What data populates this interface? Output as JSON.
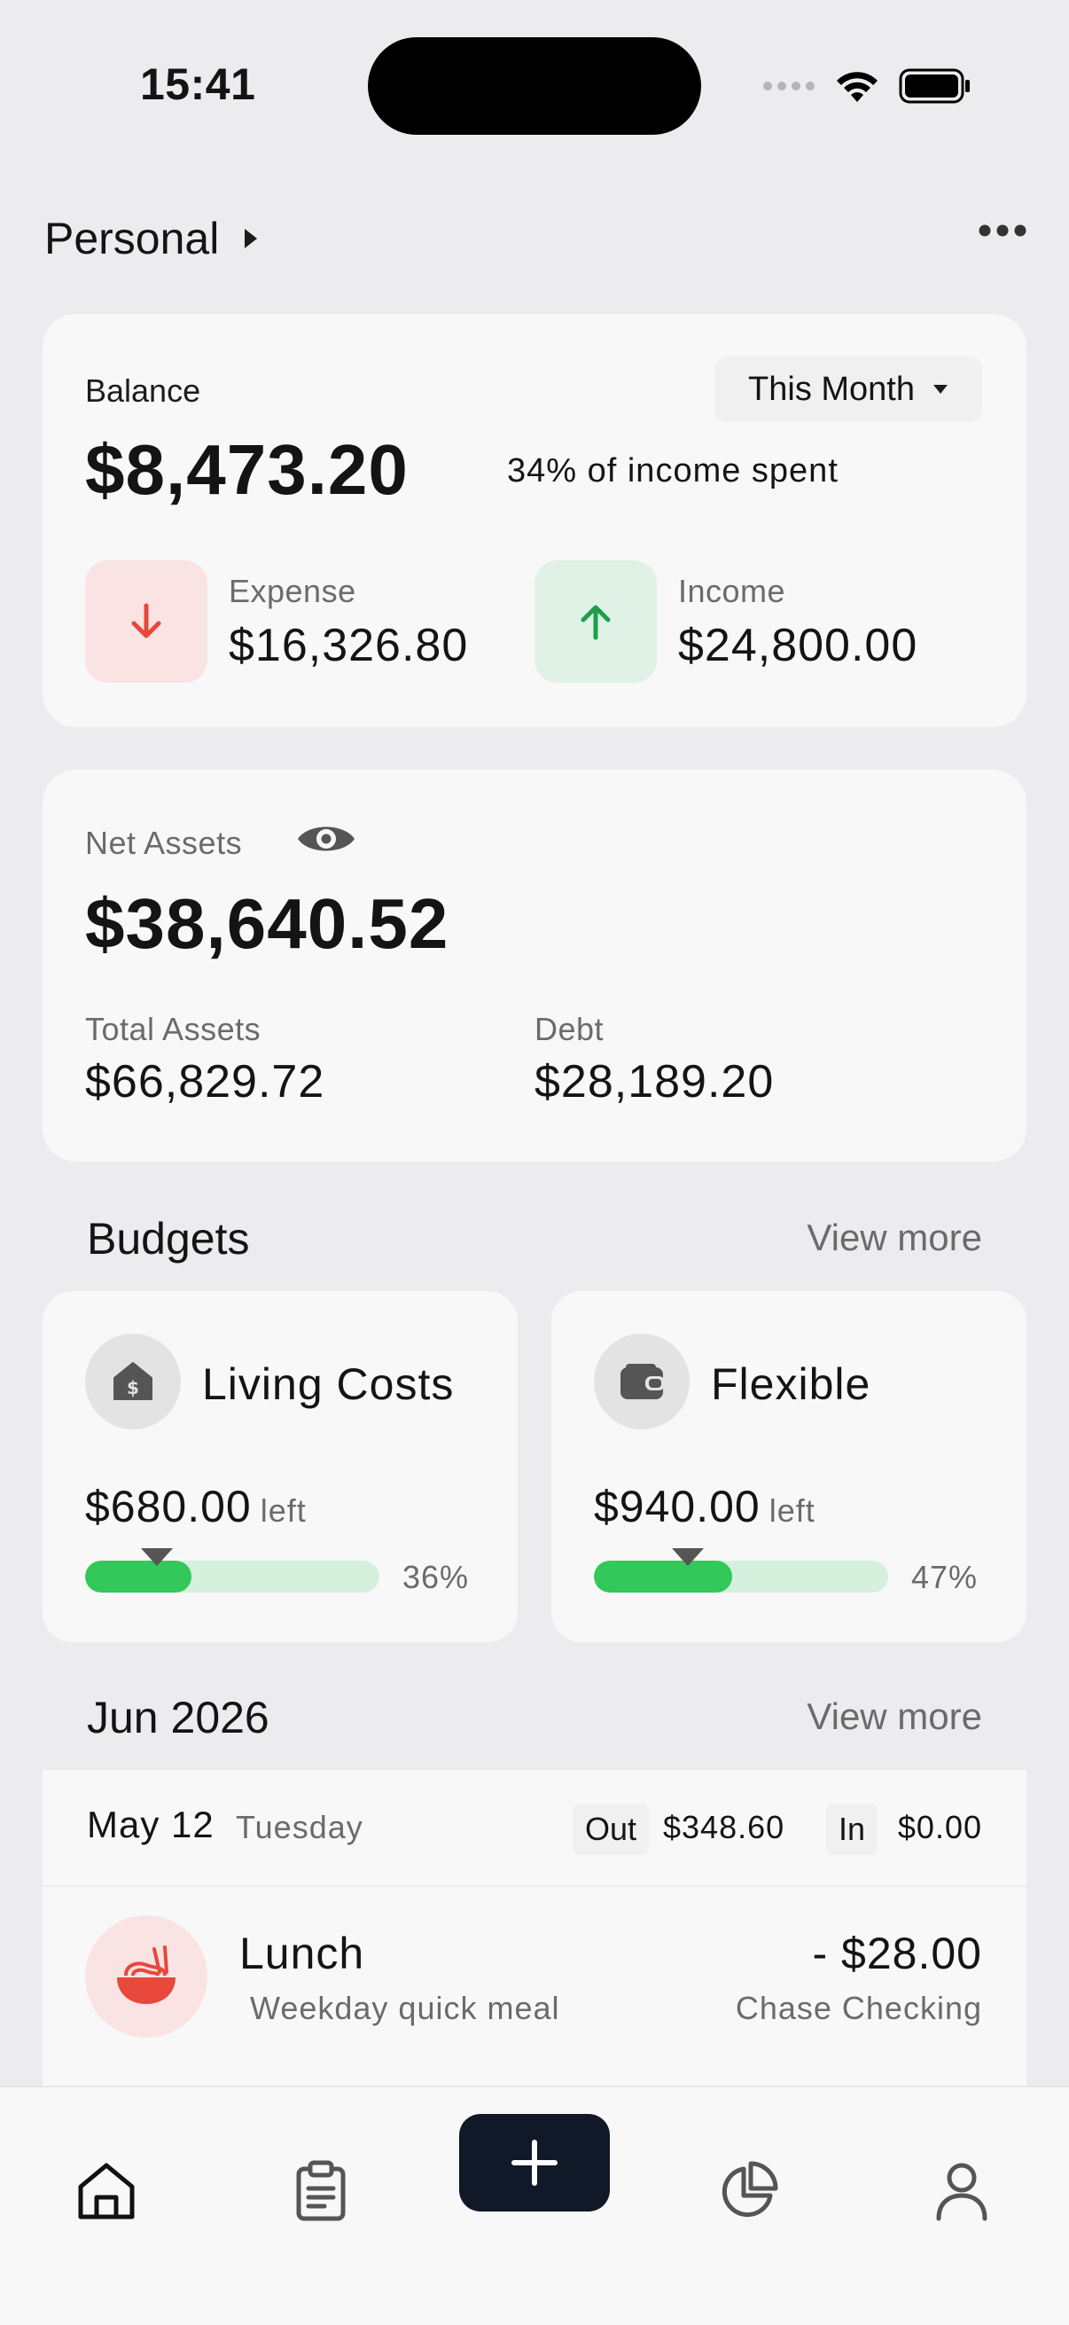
{
  "status_bar": {
    "time": "15:41"
  },
  "header": {
    "ledger_name": "Personal"
  },
  "balance": {
    "label": "Balance",
    "period": "This Month",
    "amount": "$8,473.20",
    "spent_note": "34% of income spent",
    "expense_label": "Expense",
    "expense_amount": "$16,326.80",
    "income_label": "Income",
    "income_amount": "$24,800.00"
  },
  "net_assets": {
    "label": "Net Assets",
    "amount": "$38,640.52",
    "total_assets_label": "Total Assets",
    "total_assets_amount": "$66,829.72",
    "debt_label": "Debt",
    "debt_amount": "$28,189.20"
  },
  "budgets": {
    "title": "Budgets",
    "view_more": "View more",
    "items": [
      {
        "name": "Living Costs",
        "left_amount": "$680.00",
        "left_word": "left",
        "percent_label": "36%",
        "progress": 0.36,
        "icon": "house-dollar-icon"
      },
      {
        "name": "Flexible",
        "left_amount": "$940.00",
        "left_word": "left",
        "percent_label": "47%",
        "progress": 0.47,
        "icon": "wallet-icon"
      }
    ]
  },
  "transactions": {
    "month_title": "Jun 2026",
    "view_more": "View more",
    "day": {
      "date": "May 12",
      "weekday": "Tuesday",
      "out_label": "Out",
      "out_amount": "$348.60",
      "in_label": "In",
      "in_amount": "$0.00"
    },
    "items": [
      {
        "title": "Lunch",
        "note": "Weekday quick meal",
        "amount": "- $28.00",
        "account": "Chase Checking",
        "icon": "noodle-bowl-icon"
      }
    ]
  },
  "tab_bar": {
    "tabs": [
      "home-icon",
      "clipboard-icon",
      "plus-icon",
      "pie-chart-icon",
      "person-icon"
    ]
  },
  "colors": {
    "background": "#ECECEE",
    "card": "#F8F8F8",
    "expense_red": "#E8473C",
    "income_green": "#1E9E4A",
    "progress_green": "#34C759",
    "progress_track": "#D5F0DC",
    "add_button": "#111827"
  }
}
